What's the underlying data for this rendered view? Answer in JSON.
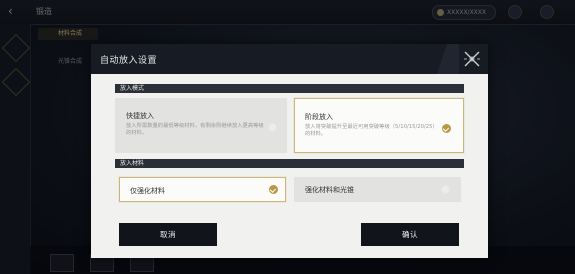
{
  "background": {
    "top_title": "锻造",
    "currency": "XXXXX/XXXX",
    "list_items": [
      "材料合成",
      "",
      "光锥合成",
      "",
      "",
      "",
      "",
      "",
      "",
      "",
      ""
    ]
  },
  "dialog": {
    "title": "自动放入设置",
    "sections": [
      {
        "label": "放入模式",
        "options": [
          {
            "title": "快捷放入",
            "desc": "放入所需数量的最低等级材料，有剩余则继续放入更高等级的材料。",
            "selected": false
          },
          {
            "title": "阶段放入",
            "desc": "放入将突破提升至最近可用突破等级（5/10/15/20/25）的材料。",
            "selected": true
          }
        ]
      },
      {
        "label": "放入材料",
        "options": [
          {
            "title": "仅强化材料",
            "selected": true
          },
          {
            "title": "强化材料和光锥",
            "selected": false
          }
        ]
      }
    ],
    "cancel_label": "取消",
    "confirm_label": "确认"
  },
  "colors": {
    "accent": "#b89845",
    "header": "#171b24",
    "panel": "#f1f1ef"
  }
}
